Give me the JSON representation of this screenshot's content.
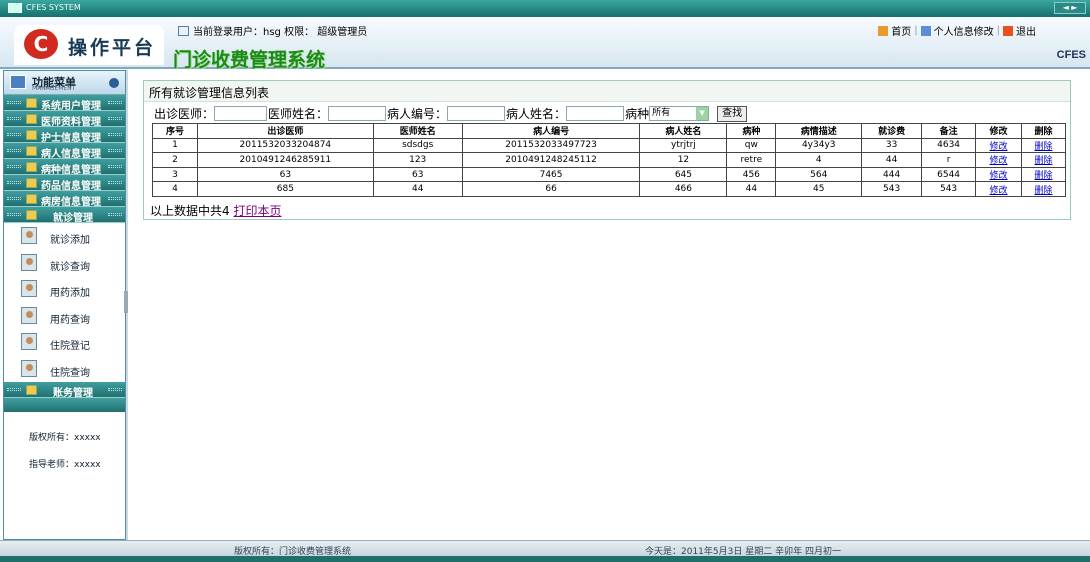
{
  "window": {
    "title": "CFES SYSTEM",
    "controls": "◄ ►"
  },
  "header": {
    "logo_text": "操作平台",
    "system_title": "门诊收费管理系统",
    "user_label": "当前登录用户：hsg 权限： 超级管理员",
    "links": {
      "home": "首页",
      "profile": "个人信息修改",
      "logout": "退出"
    },
    "brand": "CFES"
  },
  "sidebar": {
    "title": "功能菜单",
    "subtitle": "MANAGEMENT",
    "groups": [
      "系统用户管理",
      "医师资料管理",
      "护士信息管理",
      "病人信息管理",
      "病种信息管理",
      "药品信息管理",
      "病房信息管理"
    ],
    "active_group": "就诊管理",
    "sub_items": [
      "就诊添加",
      "就诊查询",
      "用药添加",
      "用药查询",
      "住院登记",
      "住院查询"
    ],
    "last_group": "账务管理",
    "copyright": "版权所有：xxxxx",
    "teacher": "指导老师：xxxxx"
  },
  "content": {
    "title": "所有就诊管理信息列表",
    "search": {
      "doctor_out": "出诊医师：",
      "doctor_name": "医师姓名：",
      "patient_no": "病人编号：",
      "patient_name": "病人姓名：",
      "disease": "病种",
      "disease_value": "所有",
      "button": "查找"
    },
    "columns": [
      "序号",
      "出诊医师",
      "医师姓名",
      "病人编号",
      "病人姓名",
      "病种",
      "病情描述",
      "就诊费",
      "备注",
      "修改",
      "删除"
    ],
    "rows": [
      [
        "1",
        "2011532033204874",
        "sdsdgs",
        "2011532033497723",
        "ytrjtrj",
        "qw",
        "4y34y3",
        "33",
        "4634",
        "修改",
        "删除"
      ],
      [
        "2",
        "2010491246285911",
        "123",
        "2010491248245112",
        "12",
        "retre",
        "4",
        "44",
        "r",
        "修改",
        "删除"
      ],
      [
        "3",
        "63",
        "63",
        "7465",
        "645",
        "456",
        "564",
        "444",
        "6544",
        "修改",
        "删除"
      ],
      [
        "4",
        "685",
        "44",
        "66",
        "466",
        "44",
        "45",
        "543",
        "543",
        "修改",
        "删除"
      ]
    ],
    "footer_text": "以上数据中共4",
    "print_link": "打印本页"
  },
  "status": {
    "copyright": "版权所有：门诊收费管理系统",
    "date": "今天是：2011年5月3日 星期二 辛卯年 四月初一"
  }
}
